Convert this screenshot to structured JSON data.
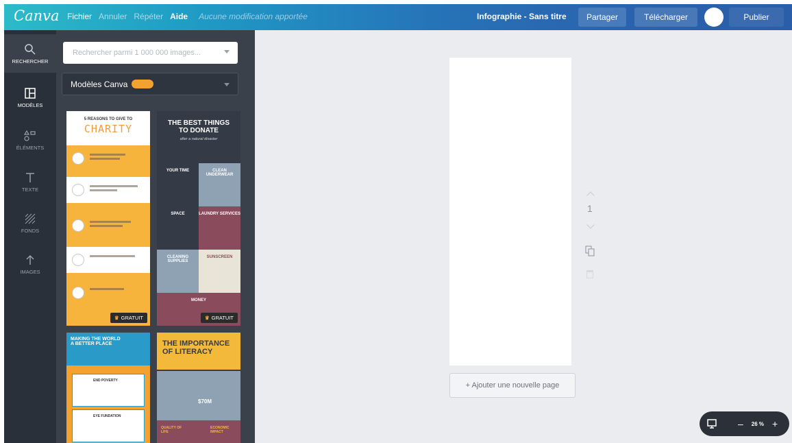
{
  "app": {
    "logo": "Canva"
  },
  "menu": {
    "file": "Fichier",
    "undo": "Annuler",
    "redo": "Répéter",
    "help": "Aide",
    "status": "Aucune modification apportée"
  },
  "header": {
    "doc_title": "Infographie - Sans titre",
    "share": "Partager",
    "download": "Télécharger",
    "publish": "Publier"
  },
  "rail": [
    {
      "label": "Rechercher",
      "icon": "search-icon"
    },
    {
      "label": "Modèles",
      "icon": "layout-icon"
    },
    {
      "label": "Éléments",
      "icon": "shapes-icon"
    },
    {
      "label": "Texte",
      "icon": "text-icon"
    },
    {
      "label": "Fonds",
      "icon": "texture-icon"
    },
    {
      "label": "Images",
      "icon": "upload-arrow-icon"
    }
  ],
  "panel": {
    "search_placeholder": "Rechercher parmi 1 000 000 images...",
    "select_label": "Modèles Canva",
    "templates": [
      {
        "subtitle": "5 REASONS TO GIVE TO",
        "title": "CHARITY",
        "free_label": "GRATUIT"
      },
      {
        "title_line1": "THE BEST THINGS",
        "title_line2": "TO DONATE",
        "subtitle": "after a natural disaster",
        "cells": [
          "YOUR TIME",
          "CLEAN UNDERWEAR",
          "SPACE",
          "LAUNDRY SERVICES",
          "CLEANING SUPPLIES",
          "SUNSCREEN",
          "MONEY"
        ],
        "free_label": "GRATUIT"
      },
      {
        "title_line1": "MAKING THE WORLD",
        "title_line2": "A BETTER PLACE",
        "item1": "END POVERTY",
        "item2": "EYE FUNDATION"
      },
      {
        "title_line1": "THE IMPORTANCE",
        "title_line2": "OF LITERACY",
        "stat": "$70M",
        "bottom_left": "QUALITY OF LIFE",
        "bottom_right": "ECONOMIC IMPACT"
      }
    ]
  },
  "canvas": {
    "page_number": "1",
    "add_page": "+ Ajouter une nouvelle page"
  },
  "zoom": {
    "value": "26 %",
    "minus": "–",
    "plus": "+"
  }
}
